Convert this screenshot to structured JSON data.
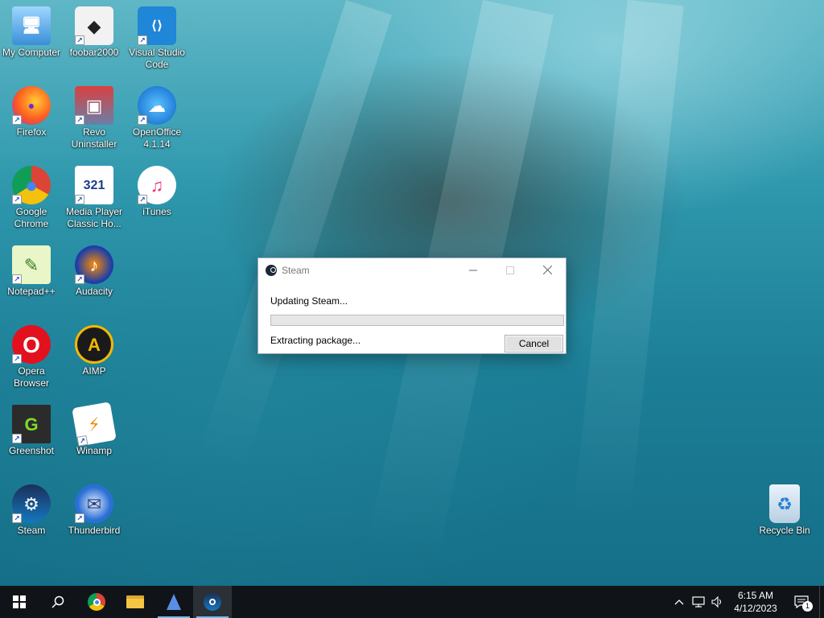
{
  "desktop": {
    "icons": [
      {
        "label": "My Computer",
        "glyph": "🖥"
      },
      {
        "label": "foobar2000",
        "glyph": "◆"
      },
      {
        "label": "Visual Studio Code",
        "glyph": "⟨⟩"
      },
      {
        "label": "Firefox",
        "glyph": "●"
      },
      {
        "label": "Revo Uninstaller",
        "glyph": "▣"
      },
      {
        "label": "OpenOffice 4.1.14",
        "glyph": "☁"
      },
      {
        "label": "Google Chrome",
        "glyph": "●"
      },
      {
        "label": "Media Player Classic Ho...",
        "glyph": "321"
      },
      {
        "label": "iTunes",
        "glyph": "♫"
      },
      {
        "label": "Notepad++",
        "glyph": "✎"
      },
      {
        "label": "Audacity",
        "glyph": "♪"
      },
      {
        "label": "Opera Browser",
        "glyph": "O"
      },
      {
        "label": "AIMP",
        "glyph": "A"
      },
      {
        "label": "Greenshot",
        "glyph": "G"
      },
      {
        "label": "Winamp",
        "glyph": "⚡"
      },
      {
        "label": "Steam",
        "glyph": "⚙"
      },
      {
        "label": "Thunderbird",
        "glyph": "✉"
      },
      {
        "label": "Recycle Bin",
        "glyph": "♻"
      }
    ]
  },
  "dialog": {
    "title": "Steam",
    "status": "Updating Steam...",
    "detail": "Extracting package...",
    "cancel_label": "Cancel",
    "progress": 0
  },
  "taskbar": {
    "clock_time": "6:15 AM",
    "clock_date": "4/12/2023",
    "notification_count": "1"
  },
  "colors": {
    "taskbar": "#101418",
    "progress_fill": "#06b025"
  }
}
